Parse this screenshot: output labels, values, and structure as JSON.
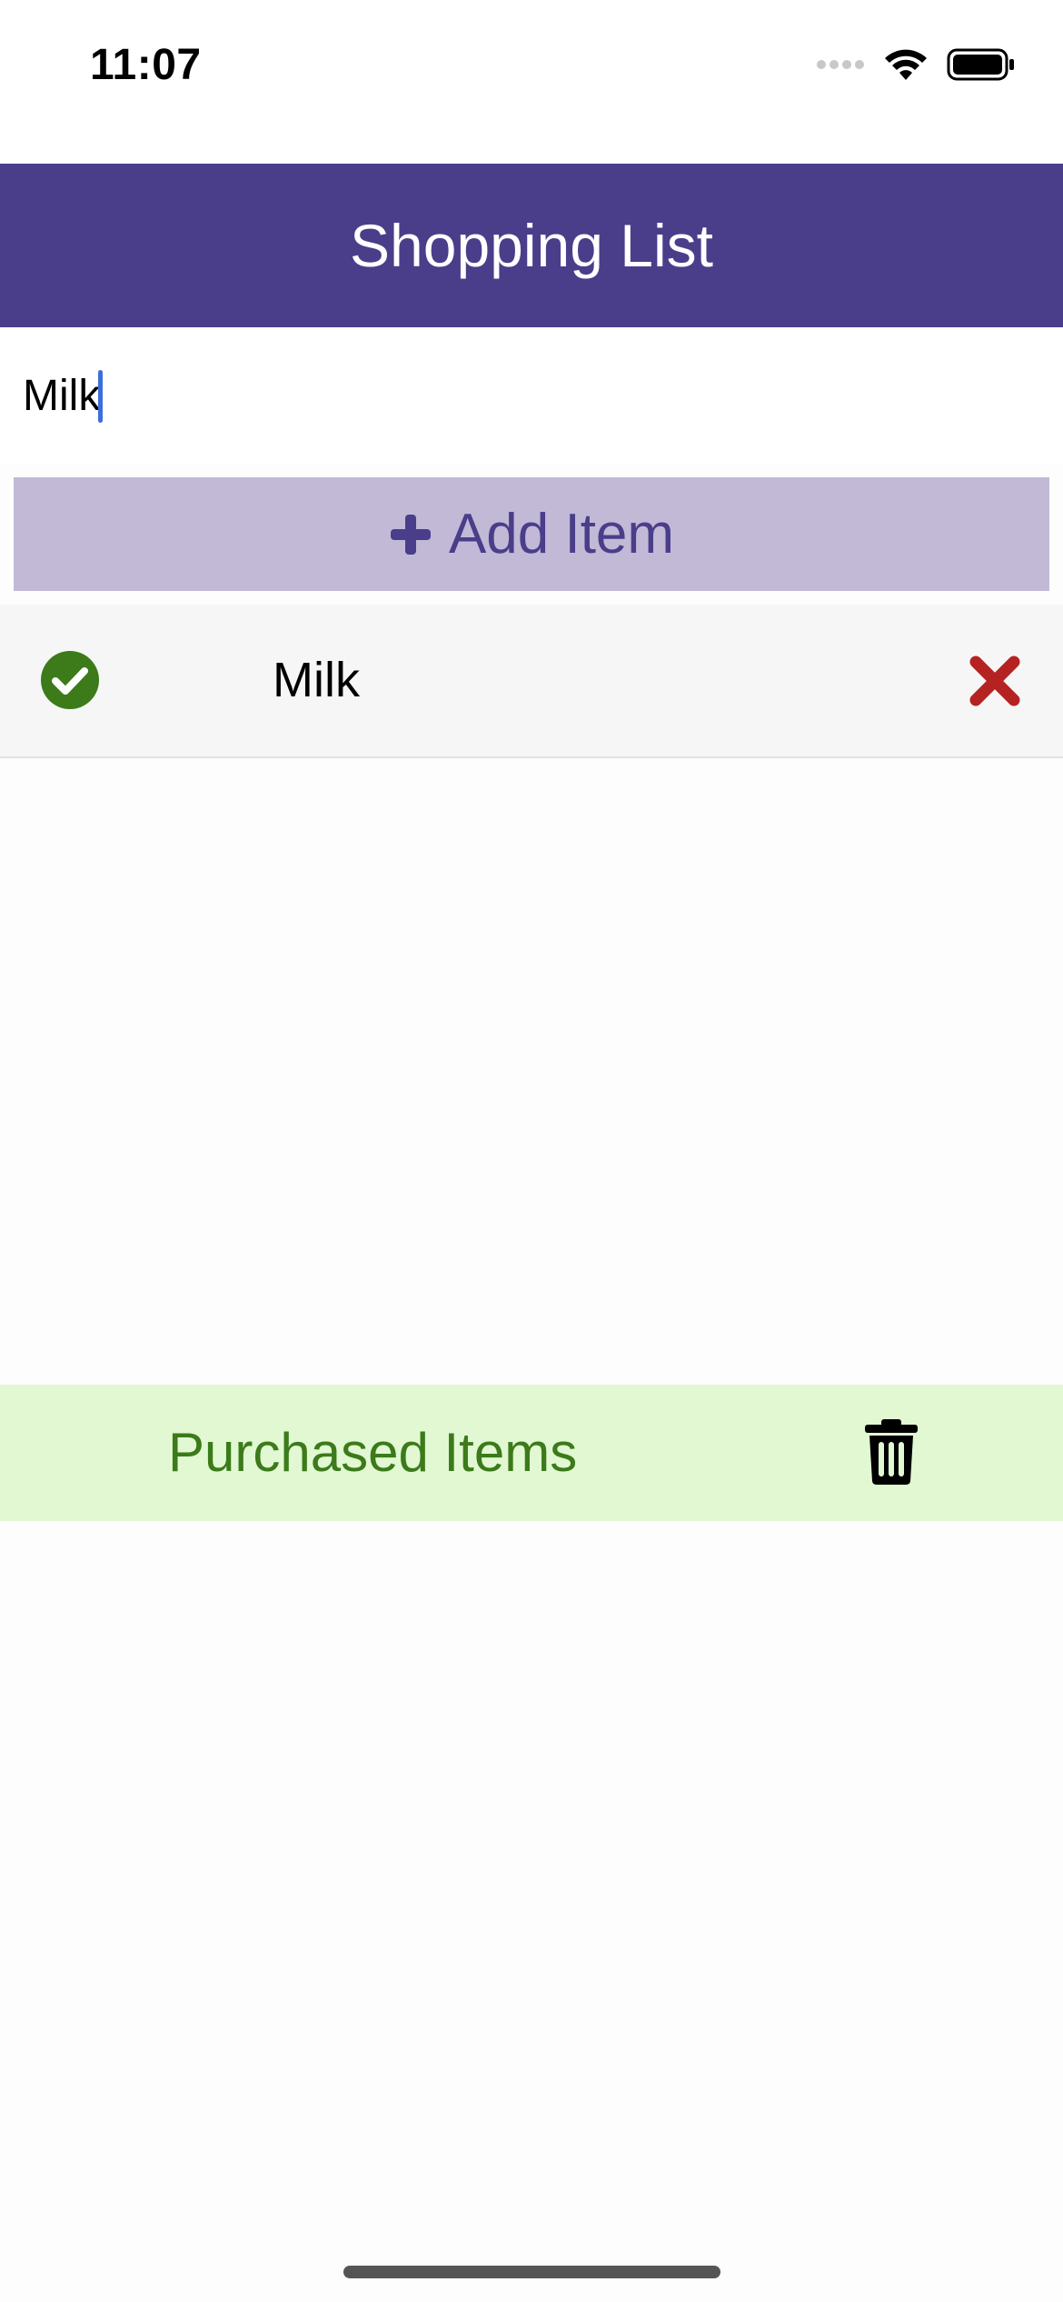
{
  "status_bar": {
    "time": "11:07",
    "icons": [
      "cellular-signal-icon",
      "wifi-icon",
      "battery-icon"
    ]
  },
  "header": {
    "title": "Shopping List",
    "background": "#4a3e8a"
  },
  "input": {
    "value": "Milk",
    "placeholder": ""
  },
  "add_button": {
    "label": "Add Item",
    "icon": "plus-icon",
    "background": "#c2b9d7",
    "text_color": "#4a3e8a"
  },
  "list": {
    "items": [
      {
        "label": "Milk",
        "check_icon": "check-circle-icon",
        "check_color": "#3c7a1a",
        "delete_icon": "close-x-icon",
        "delete_color": "#b52222"
      }
    ]
  },
  "purchased": {
    "label": "Purchased Items",
    "icon": "trash-icon",
    "background": "#e1f8d3",
    "text_color": "#3c7a1a"
  }
}
